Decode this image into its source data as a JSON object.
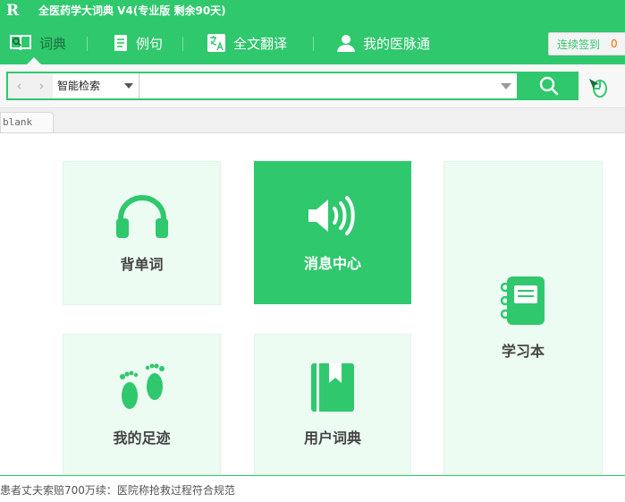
{
  "app": {
    "logo_text": "R",
    "title": "全医药学大词典 V4(专业版 剩余90天)"
  },
  "nav": {
    "items": [
      {
        "label": "词典",
        "icon": "dictionary-icon"
      },
      {
        "label": "例句",
        "icon": "document-icon"
      },
      {
        "label": "全文翻译",
        "icon": "translate-icon"
      },
      {
        "label": "我的医脉通",
        "icon": "user-icon"
      }
    ],
    "checkin_label": "连续签到",
    "checkin_count": "0"
  },
  "search": {
    "back_arrow": "‹",
    "forward_arrow": "›",
    "mode": "智能检索",
    "value": "",
    "placeholder": ""
  },
  "tabs": [
    {
      "label": "blank"
    }
  ],
  "tiles": [
    {
      "label": "背单词",
      "icon": "headphones-icon"
    },
    {
      "label": "消息中心",
      "icon": "speaker-icon"
    },
    {
      "label": "学习本",
      "icon": "notebook-icon"
    },
    {
      "label": "我的足迹",
      "icon": "footprints-icon"
    },
    {
      "label": "用户词典",
      "icon": "bookmark-book-icon"
    }
  ],
  "status": {
    "news": "患者丈夫索赔700万续：医院称抢救过程符合规范"
  },
  "colors": {
    "brand_green": "#2fc86d",
    "tile_bg": "#edfcf3",
    "checkin_count": "#ff6a00"
  }
}
